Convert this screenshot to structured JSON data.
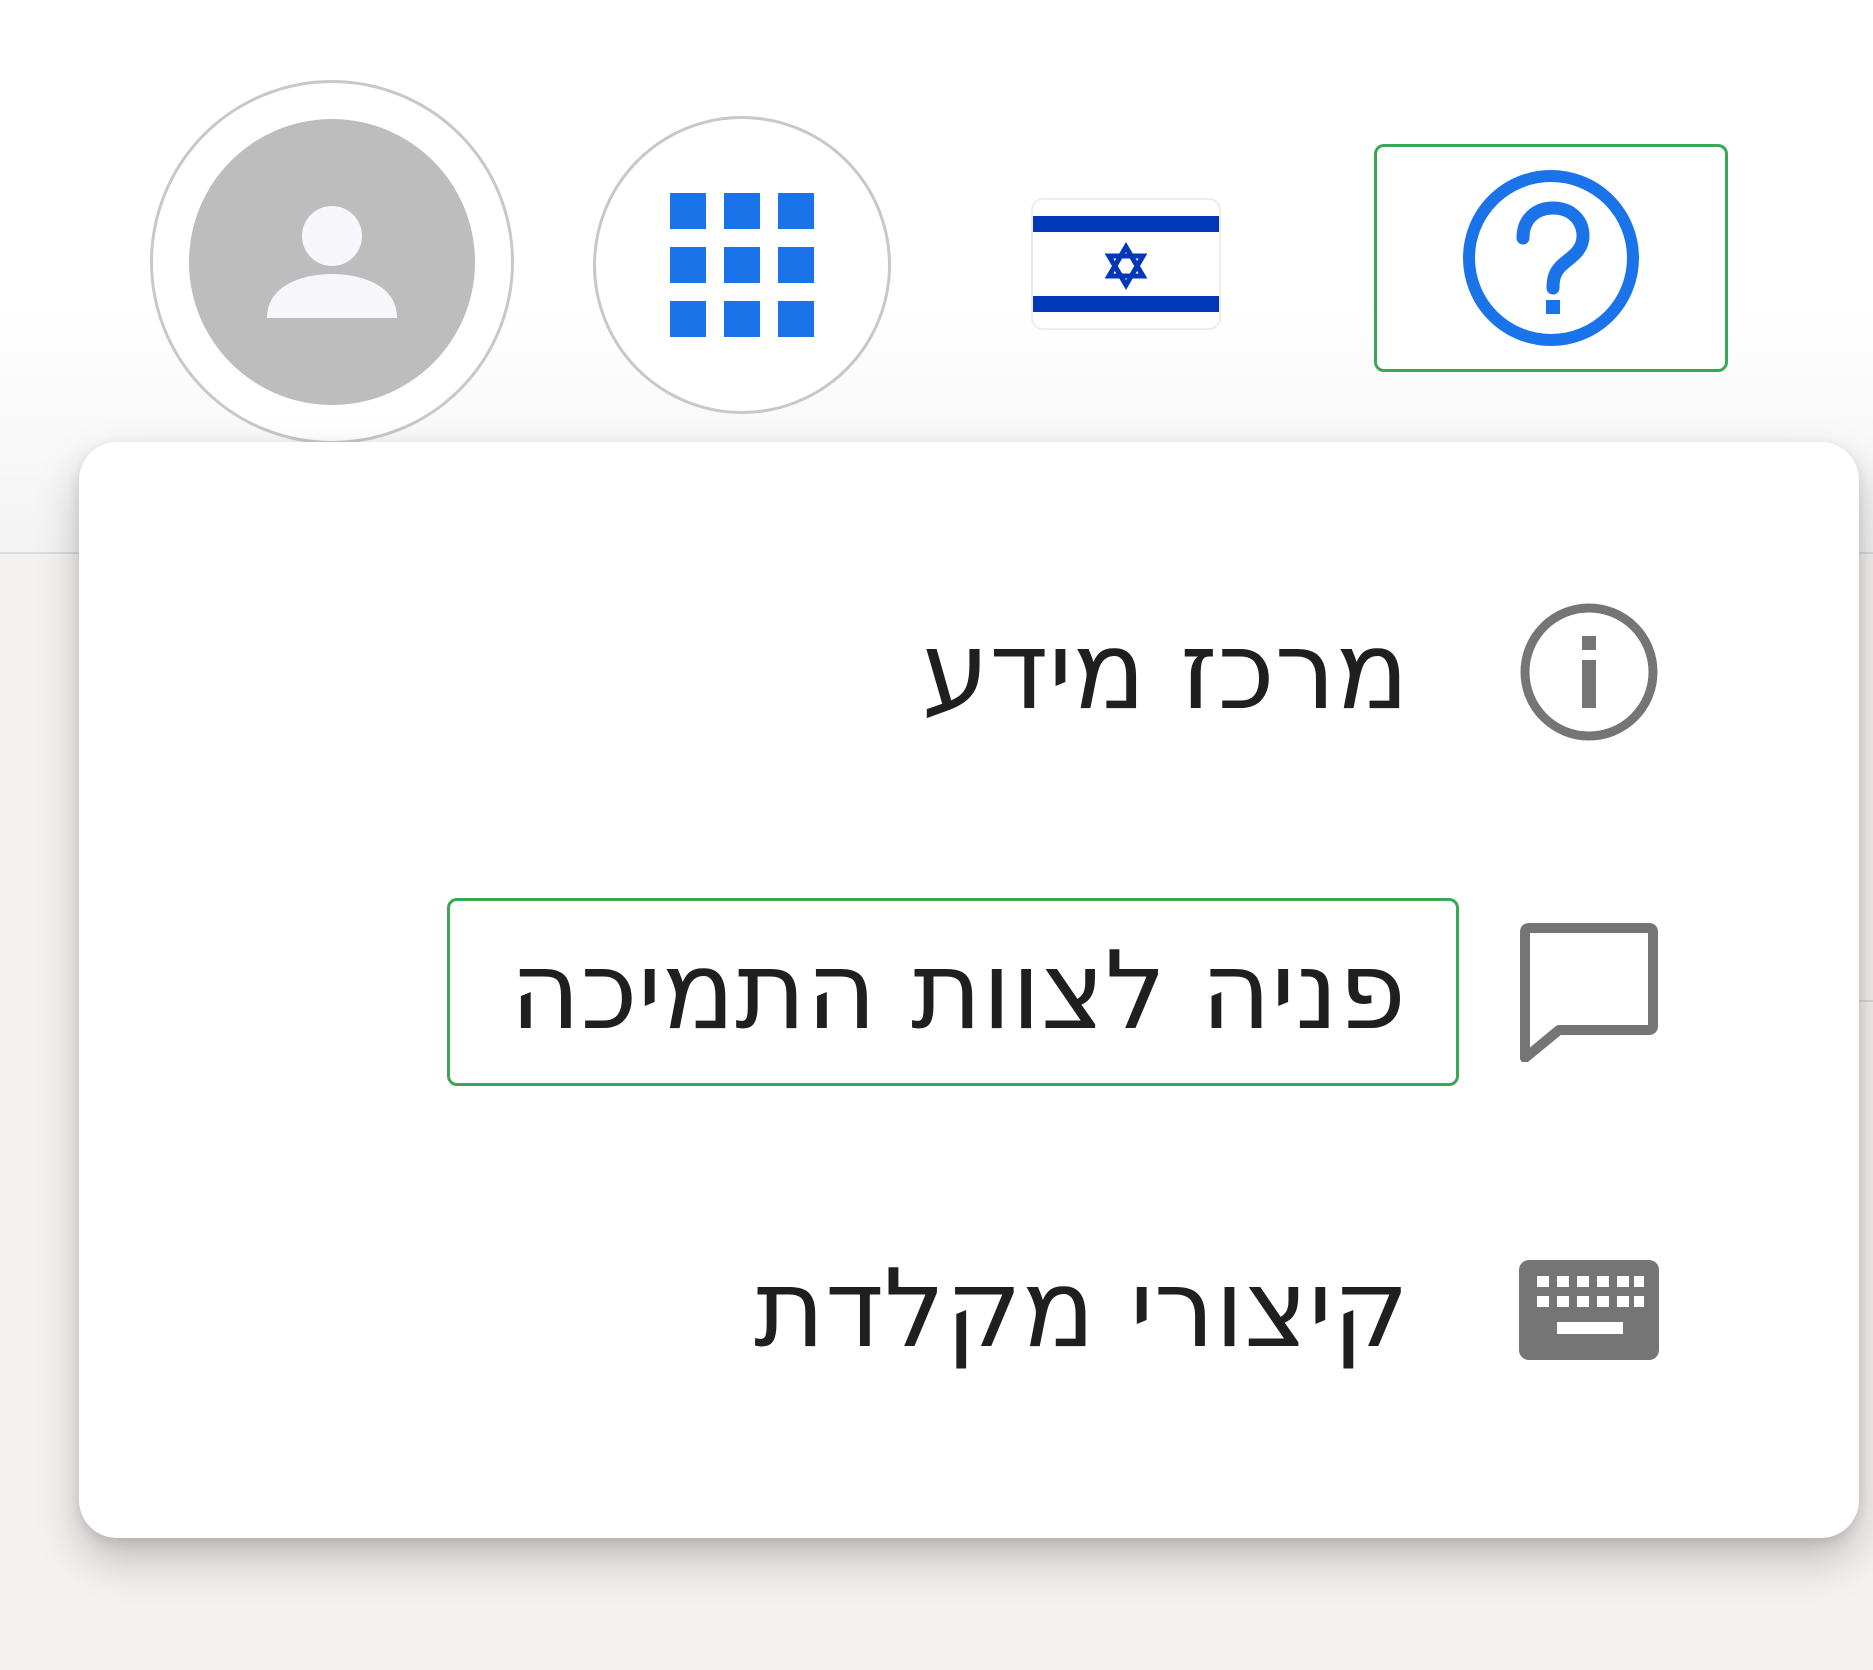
{
  "header": {
    "avatar_icon": "account-circle-icon",
    "apps_icon": "apps-grid-icon",
    "language_icon": "israel-flag-icon",
    "help_icon": "help-circle-icon"
  },
  "help_menu": {
    "items": [
      {
        "label": "מרכז מידע",
        "icon": "info-icon"
      },
      {
        "label": "פניה לצוות התמיכה",
        "icon": "feedback-chat-icon"
      },
      {
        "label": "קיצורי מקלדת",
        "icon": "keyboard-icon"
      }
    ]
  },
  "colors": {
    "accent_blue": "#1a73e8",
    "highlight_green": "#3aa757",
    "icon_gray": "#757575",
    "avatar_gray": "#bdbdbd",
    "flag_blue": "#0038b8"
  }
}
